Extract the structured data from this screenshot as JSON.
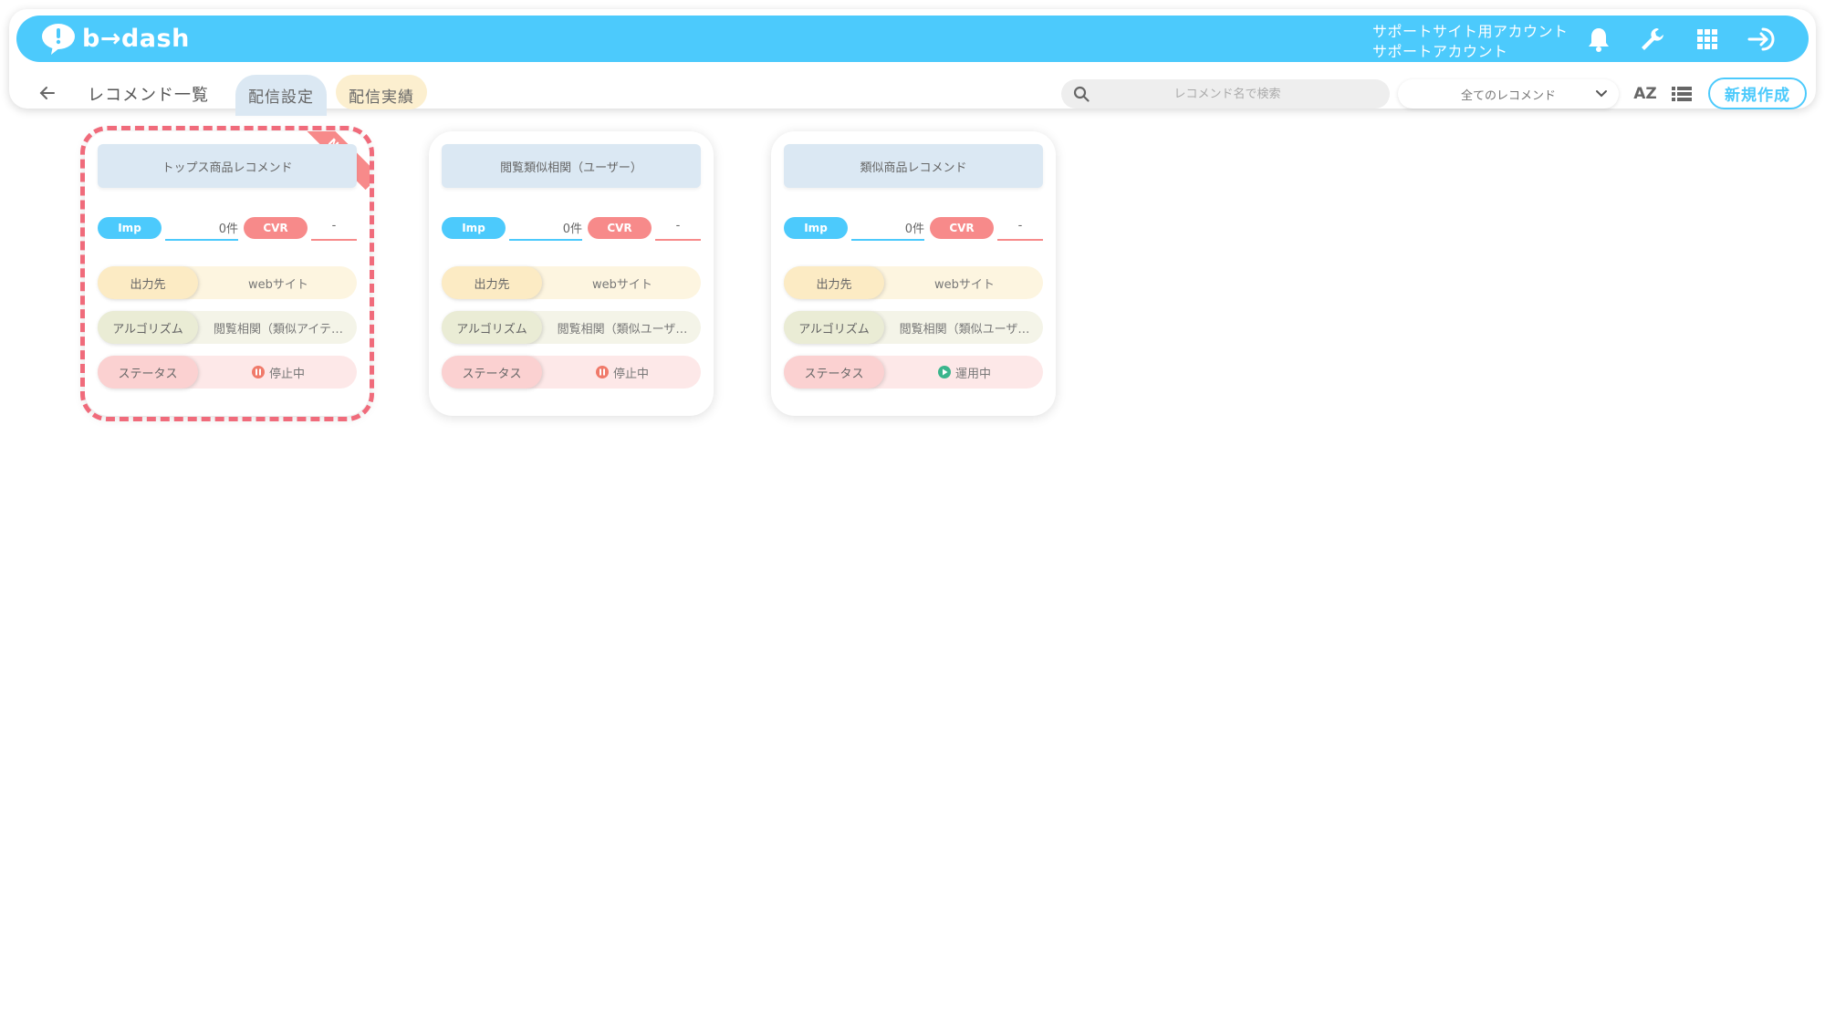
{
  "header": {
    "logo_text": "b→dash",
    "account_line1": "サポートサイト用アカウント",
    "account_line2": "サポートアカウント",
    "icons": [
      "bell-icon",
      "wrench-icon",
      "apps-grid-icon",
      "logout-icon"
    ],
    "color": "#4ccafc"
  },
  "toolbar": {
    "page_title": "レコメンド一覧",
    "tabs": [
      {
        "label": "配信設定",
        "active": true
      },
      {
        "label": "配信実績",
        "active": false
      }
    ],
    "search_placeholder": "レコメンド名で検索",
    "filter_selected": "全てのレコメンド",
    "sort_label": "AZ",
    "new_button_label": "新規作成"
  },
  "cards": [
    {
      "title": "トップス商品レコメンド",
      "badge": "NEW",
      "imp_label": "Imp",
      "imp_value": "0件",
      "cvr_label": "CVR",
      "cvr_value": "-",
      "output_label": "出力先",
      "output_value": "webサイト",
      "algo_label": "アルゴリズム",
      "algo_value": "閲覧相関（類似アイテ…",
      "status_label": "ステータス",
      "status_value": "停止中",
      "status_state": "paused",
      "highlighted": true
    },
    {
      "title": "閲覧類似相関（ユーザー）",
      "imp_label": "Imp",
      "imp_value": "0件",
      "cvr_label": "CVR",
      "cvr_value": "-",
      "output_label": "出力先",
      "output_value": "webサイト",
      "algo_label": "アルゴリズム",
      "algo_value": "閲覧相関（類似ユーザ…",
      "status_label": "ステータス",
      "status_value": "停止中",
      "status_state": "paused"
    },
    {
      "title": "類似商品レコメンド",
      "imp_label": "Imp",
      "imp_value": "0件",
      "cvr_label": "CVR",
      "cvr_value": "-",
      "output_label": "出力先",
      "output_value": "webサイト",
      "algo_label": "アルゴリズム",
      "algo_value": "閲覧相関（類似ユーザ…",
      "status_label": "ステータス",
      "status_value": "運用中",
      "status_state": "running"
    }
  ],
  "colors": {
    "imp": "#4ccafc",
    "cvr": "#f78a8a",
    "paused": "#f07a6a",
    "running": "#3bb58c",
    "highlight": "#f06b7b"
  }
}
